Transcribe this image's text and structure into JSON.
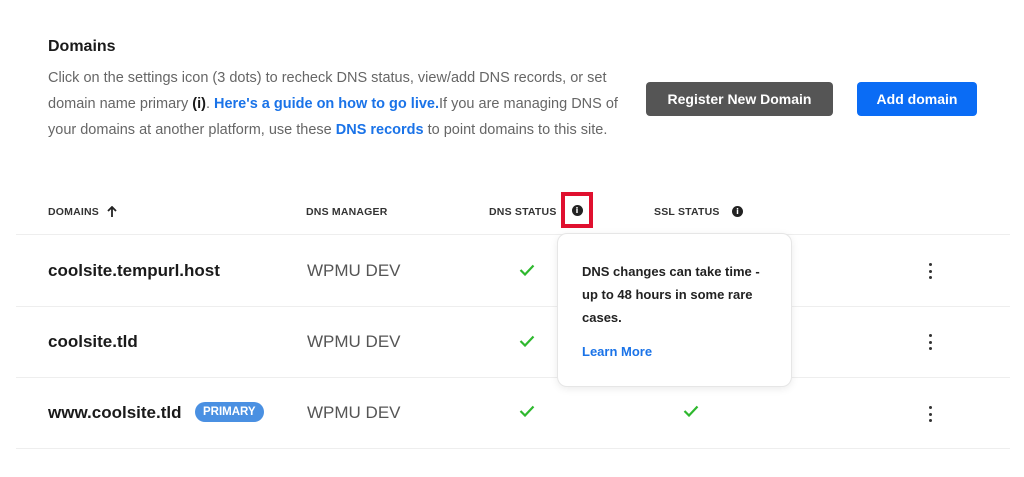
{
  "section": {
    "title": "Domains",
    "description": {
      "part1": "Click on the settings icon (3 dots) to recheck DNS status, view/add DNS records, or set domain name primary ",
      "bold_i": "(i)",
      "part2": ". ",
      "guide_link": "Here's a guide on how to go live.",
      "part3": "If you are managing DNS of your domains at another platform, use these ",
      "dns_records_link": "DNS records",
      "part4": " to point domains to this site."
    }
  },
  "buttons": {
    "register": "Register New Domain",
    "add": "Add domain"
  },
  "table": {
    "headers": {
      "domains": "DOMAINS",
      "dns_manager": "DNS MANAGER",
      "dns_status": "DNS STATUS",
      "ssl_status": "SSL STATUS"
    },
    "rows": [
      {
        "domain": "coolsite.tempurl.host",
        "dns_manager": "WPMU DEV",
        "dns_ok": true,
        "ssl_ok": true
      },
      {
        "domain": "coolsite.tld",
        "dns_manager": "WPMU DEV",
        "dns_ok": true,
        "ssl_ok": true
      },
      {
        "domain": "www.coolsite.tld",
        "badge": "PRIMARY",
        "dns_manager": "WPMU DEV",
        "dns_ok": true,
        "ssl_ok": true
      }
    ]
  },
  "tooltip": {
    "text": "DNS changes can take time - up to 48 hours in some rare cases.",
    "link": "Learn More"
  },
  "icons": {
    "sort": "arrow-up-icon",
    "info": "info-icon",
    "check": "check-icon",
    "more": "kebab-menu-icon",
    "info_glyph": "i"
  },
  "colors": {
    "accent": "#0a6cf5",
    "register_button": "#555555",
    "check": "#2eb82e",
    "badge": "#4a90e2",
    "highlight": "#e0102f"
  }
}
